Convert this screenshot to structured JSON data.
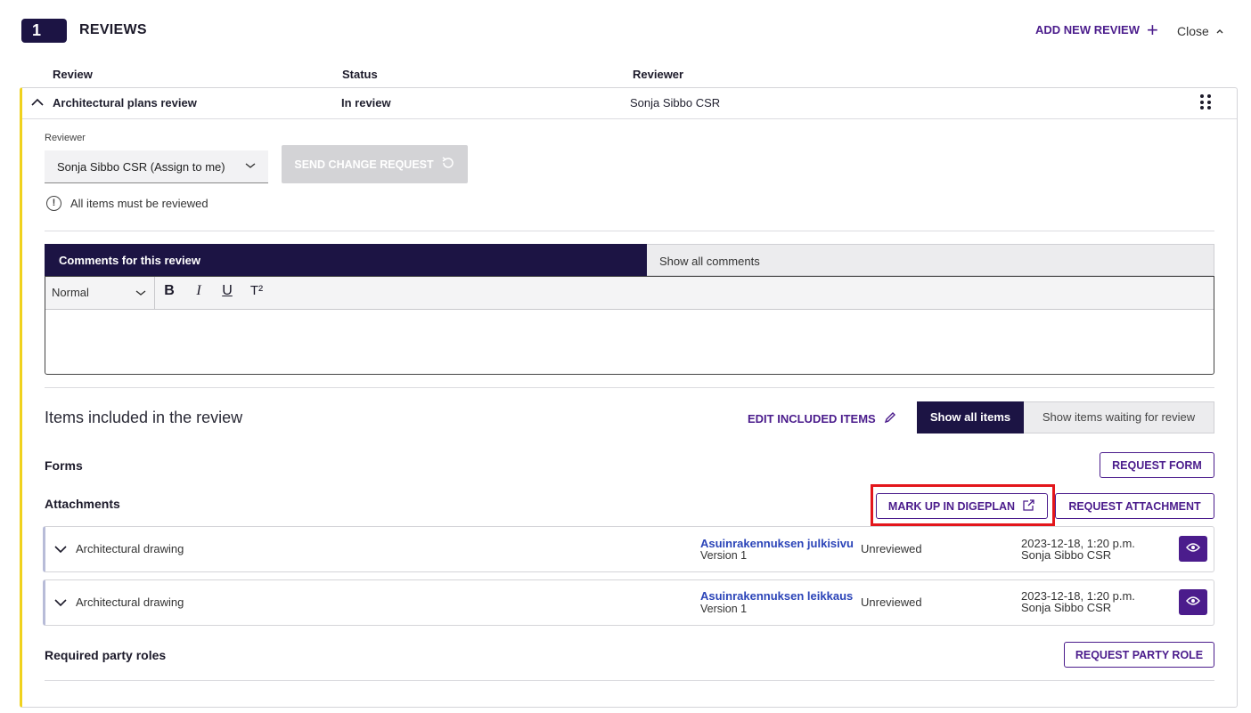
{
  "header": {
    "count": "1",
    "title": "REVIEWS",
    "add_review_label": "ADD NEW REVIEW",
    "close_label": "Close"
  },
  "columns": {
    "review": "Review",
    "status": "Status",
    "reviewer": "Reviewer"
  },
  "review": {
    "title": "Architectural plans review",
    "status": "In review",
    "reviewer": "Sonja Sibbo CSR",
    "reviewer_field_label": "Reviewer",
    "reviewer_select_value": "Sonja Sibbo CSR (Assign to me)",
    "send_change_request_label": "SEND CHANGE REQUEST",
    "info_text": "All items must be reviewed"
  },
  "comments": {
    "tab_active": "Comments for this review",
    "tab_inactive": "Show all comments",
    "format_value": "Normal",
    "toolbar": {
      "bold": "B",
      "italic": "I",
      "underline": "U",
      "superscript": "T²"
    }
  },
  "items": {
    "title": "Items included in the review",
    "edit_label": "EDIT INCLUDED ITEMS",
    "show_all_label": "Show all items",
    "show_waiting_label": "Show items waiting for review",
    "forms_label": "Forms",
    "request_form_label": "REQUEST FORM",
    "attachments_label": "Attachments",
    "markup_label": "MARK UP IN DIGEPLAN",
    "request_attachment_label": "REQUEST ATTACHMENT",
    "attachments": [
      {
        "type": "Architectural drawing",
        "name": "Asuinrakennuksen julkisivu",
        "version": "Version 1",
        "status": "Unreviewed",
        "date": "2023-12-18, 1:20 p.m.",
        "author": "Sonja Sibbo CSR"
      },
      {
        "type": "Architectural drawing",
        "name": "Asuinrakennuksen leikkaus",
        "version": "Version 1",
        "status": "Unreviewed",
        "date": "2023-12-18, 1:20 p.m.",
        "author": "Sonja Sibbo CSR"
      }
    ],
    "party_roles_label": "Required party roles",
    "request_party_role_label": "REQUEST PARTY ROLE"
  },
  "colors": {
    "primary_dark": "#1c1444",
    "accent_purple": "#4b1c8c",
    "highlight_red": "#e3161b",
    "card_accent_yellow": "#f0d21e",
    "link_blue": "#2b44b8"
  }
}
